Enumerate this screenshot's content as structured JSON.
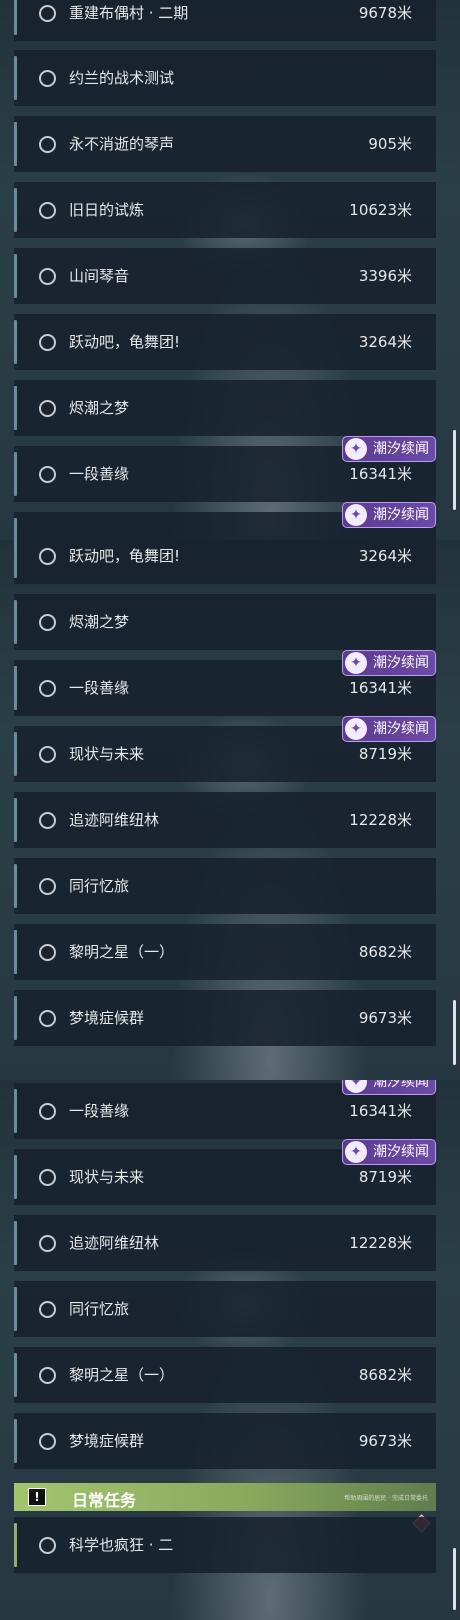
{
  "badge_label": "潮汐续闻",
  "screens": [
    {
      "rows": [
        {
          "title": "重建布偶村 · 二期",
          "dist": "9678米"
        },
        {
          "title": "约兰的战术测试",
          "dist": ""
        },
        {
          "title": "永不消逝的琴声",
          "dist": "905米"
        },
        {
          "title": "旧日的试炼",
          "dist": "10623米"
        },
        {
          "title": "山间琴音",
          "dist": "3396米"
        },
        {
          "title": "跃动吧，龟舞团!",
          "dist": "3264米"
        },
        {
          "title": "烬潮之梦",
          "dist": ""
        },
        {
          "title": "一段善缘",
          "dist": "16341米"
        },
        {
          "title": "",
          "dist": ""
        }
      ]
    },
    {
      "rows": [
        {
          "title": "跃动吧，龟舞团!",
          "dist": "3264米"
        },
        {
          "title": "烬潮之梦",
          "dist": ""
        },
        {
          "title": "一段善缘",
          "dist": "16341米"
        },
        {
          "title": "现状与未来",
          "dist": "8719米"
        },
        {
          "title": "追迹阿维纽林",
          "dist": "12228米"
        },
        {
          "title": "同行忆旅",
          "dist": ""
        },
        {
          "title": "黎明之星（一）",
          "dist": "8682米"
        },
        {
          "title": "梦境症候群",
          "dist": "9673米"
        }
      ]
    },
    {
      "rows": [
        {
          "title": "一段善缘",
          "dist": "16341米"
        },
        {
          "title": "现状与未来",
          "dist": "8719米"
        },
        {
          "title": "追迹阿维纽林",
          "dist": "12228米"
        },
        {
          "title": "同行忆旅",
          "dist": ""
        },
        {
          "title": "黎明之星（一）",
          "dist": "8682米"
        },
        {
          "title": "梦境症候群",
          "dist": "9673米"
        }
      ],
      "section": {
        "label": "日常任务",
        "sub": "帮助周围的居民 · 完成日常委托",
        "rows": [
          {
            "title": "科学也疯狂 · 二",
            "dist": ""
          }
        ]
      }
    }
  ]
}
